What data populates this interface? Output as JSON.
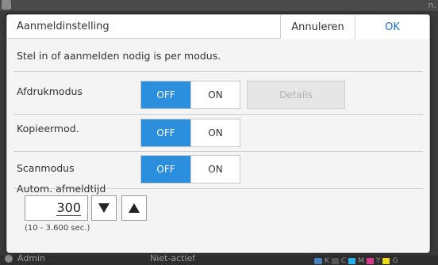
{
  "background": {
    "corner_text": "n.",
    "user": "Admin",
    "status": "Niet-actief",
    "ink": [
      {
        "label": "K",
        "color": "#555555"
      },
      {
        "label": "C",
        "color": "#2ab0e8"
      },
      {
        "label": "M",
        "color": "#d83a8c"
      },
      {
        "label": "Y",
        "color": "#e8d820"
      },
      {
        "label": "G",
        "color": "#888888"
      }
    ]
  },
  "dialog": {
    "title": "Aanmeldinstelling",
    "cancel_label": "Annuleren",
    "ok_label": "OK",
    "description": "Stel in of aanmelden nodig is per modus."
  },
  "modes": [
    {
      "label": "Afdrukmodus",
      "off_label": "OFF",
      "on_label": "ON",
      "selected": "OFF",
      "details_label": "Details",
      "details_enabled": false
    },
    {
      "label": "Kopieermod.",
      "off_label": "OFF",
      "on_label": "ON",
      "selected": "OFF"
    },
    {
      "label": "Scanmodus",
      "off_label": "OFF",
      "on_label": "ON",
      "selected": "OFF"
    }
  ],
  "timeout": {
    "label": "Autom. afmeldtijd",
    "value": "300",
    "range_hint": "(10 - 3.600 sec.)"
  },
  "colors": {
    "accent": "#2b8fde",
    "ok_text": "#1a6fd0"
  }
}
